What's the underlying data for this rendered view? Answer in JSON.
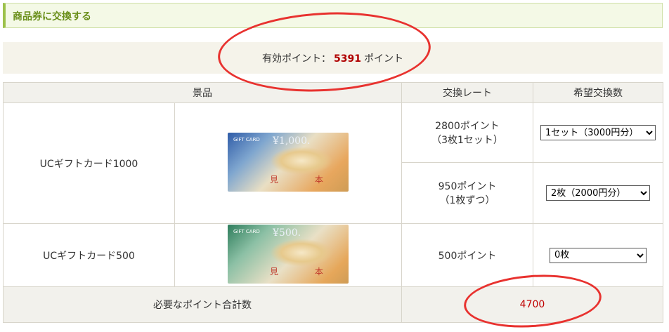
{
  "header": {
    "title": "商品券に交換する"
  },
  "points": {
    "label": "有効ポイント：",
    "value": "5391",
    "unit": "ポイント"
  },
  "table": {
    "headers": [
      "景品",
      "交換レート",
      "希望交換数"
    ],
    "items": [
      {
        "name": "UCギフトカード1000",
        "card": {
          "brand": "GIFT CARD",
          "amount": "¥1,000.",
          "stamp": "見 本"
        },
        "options": [
          {
            "rate_line1": "2800ポイント",
            "rate_line2": "（3枚1セット）",
            "selected": "1セット（3000円分）"
          },
          {
            "rate_line1": "950ポイント",
            "rate_line2": "（1枚ずつ）",
            "selected": "2枚（2000円分）"
          }
        ]
      },
      {
        "name": "UCギフトカード500",
        "card": {
          "brand": "GIFT CARD",
          "amount": "¥500.",
          "stamp": "見 本"
        },
        "options": [
          {
            "rate_line1": "500ポイント",
            "rate_line2": "",
            "selected": "0枚"
          }
        ]
      }
    ],
    "total": {
      "label": "必要なポイント合計数",
      "value": "4700"
    }
  },
  "colors": {
    "accent_green": "#6a8f1a",
    "points_red": "#b00000",
    "annotation_red": "#e8322f"
  }
}
